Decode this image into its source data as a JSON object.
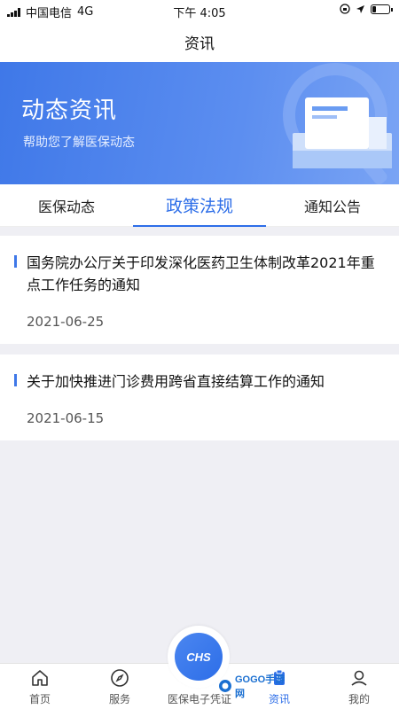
{
  "status_bar": {
    "carrier": "中国电信",
    "network": "4G",
    "time": "下午 4:05",
    "battery_level": 0.25
  },
  "nav": {
    "title": "资讯"
  },
  "banner": {
    "title": "动态资讯",
    "subtitle": "帮助您了解医保动态",
    "accent_color": "#3f78e8"
  },
  "tabs": [
    {
      "label": "医保动态",
      "active": false
    },
    {
      "label": "政策法规",
      "active": true
    },
    {
      "label": "通知公告",
      "active": false
    }
  ],
  "news": [
    {
      "title": "国务院办公厅关于印发深化医药卫生体制改革2021年重点工作任务的通知",
      "date": "2021-06-25"
    },
    {
      "title": "关于加快推进门诊费用跨省直接结算工作的通知",
      "date": "2021-06-15"
    }
  ],
  "bottom_tabs": {
    "home": {
      "label": "首页",
      "icon": "home-icon"
    },
    "service": {
      "label": "服务",
      "icon": "compass-icon"
    },
    "certificate": {
      "label": "医保电子凭证",
      "icon": "chs-logo",
      "logo_text": "CHS"
    },
    "news": {
      "label": "资讯",
      "icon": "document-icon",
      "active": true
    },
    "mine": {
      "label": "我的",
      "icon": "user-icon"
    }
  },
  "watermark": {
    "text": "GOGO手游网"
  }
}
